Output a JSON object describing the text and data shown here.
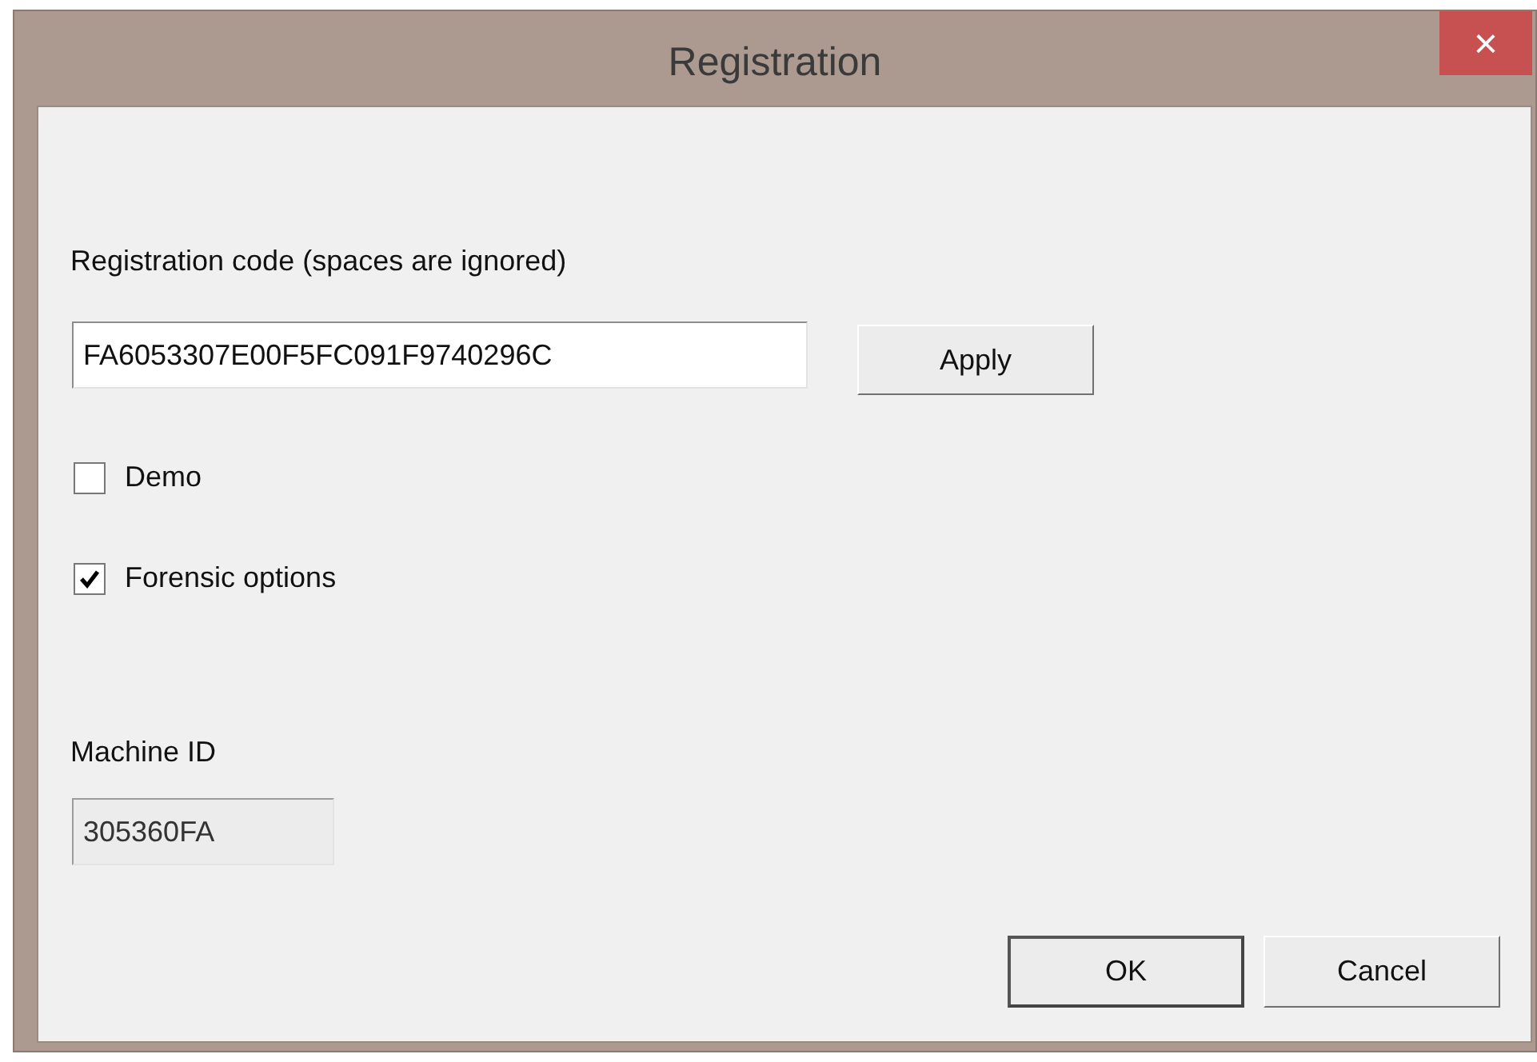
{
  "window": {
    "title": "Registration",
    "close": "×"
  },
  "registration_code": {
    "label": "Registration code (spaces are ignored)",
    "value": "FA6053307E00F5FC091F9740296C"
  },
  "apply_button": "Apply",
  "options": [
    {
      "label": "Demo",
      "checked": false
    },
    {
      "label": "Forensic options",
      "checked": true
    }
  ],
  "machine_id": {
    "label": "Machine ID",
    "value": "305360FA",
    "disabled": true
  },
  "buttons": [
    {
      "label": "OK",
      "selected": true
    },
    {
      "label": "Cancel",
      "selected": false
    }
  ]
}
